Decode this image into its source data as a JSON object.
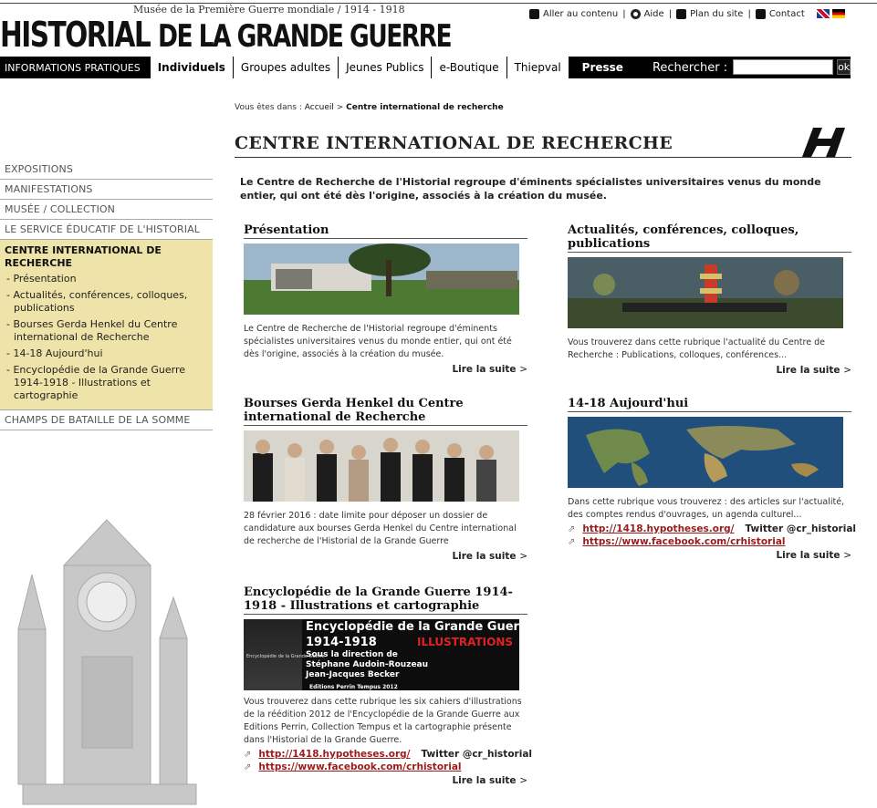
{
  "header": {
    "subtitle": "Musée de la Première Guerre mondiale / 1914 - 1918",
    "logo_word1": "HISTORIAL",
    "logo_word2": "DE LA GRANDE GUERRE",
    "util_links": [
      "Aller au contenu",
      "Aide",
      "Plan du site",
      "Contact"
    ],
    "util_icons": [
      "content-icon",
      "eye-icon",
      "sitemap-icon",
      "mail-icon"
    ]
  },
  "nav": {
    "items": [
      "INFORMATIONS PRATIQUES",
      "Individuels",
      "Groupes adultes",
      "Jeunes Publics",
      "e-Boutique",
      "Thiepval"
    ],
    "press": "Presse",
    "search_label": "Rechercher :",
    "search_value": "",
    "ok": "ok"
  },
  "sidebar": {
    "items_top": [
      "EXPOSITIONS",
      "MANIFESTATIONS",
      "MUSÉE / COLLECTION",
      "LE SERVICE ÉDUCATIF DE L'HISTORIAL"
    ],
    "active_head": "CENTRE INTERNATIONAL DE RECHERCHE",
    "active_sub": [
      "- Présentation",
      "- Actualités, conférences, colloques, publications",
      "- Bourses Gerda Henkel du Centre international de Recherche",
      "- 14-18 Aujourd'hui",
      "- Encyclopédie de la Grande Guerre 1914-1918 - Illustrations et cartographie"
    ],
    "items_bottom": [
      "CHAMPS DE BATAILLE DE LA SOMME"
    ]
  },
  "main": {
    "breadcrumb_prefix": "Vous êtes dans : ",
    "breadcrumb_home": "Accueil",
    "breadcrumb_sep": " > ",
    "breadcrumb_current": "Centre international de recherche",
    "title": "CENTRE INTERNATIONAL DE RECHERCHE",
    "intro": "Le Centre de Recherche de l'Historial regroupe d'éminents spécialistes universitaires venus du monde entier, qui ont été dès l'origine, associés à la création du musée.",
    "read_more": "Lire la suite",
    "read_more_arrow": ">",
    "cards": [
      {
        "title": "Présentation",
        "text": "Le Centre de Recherche de l'Historial regroupe d'éminents spécialistes universitaires venus du monde entier, qui ont été dès l'origine, associés à la création du musée."
      },
      {
        "title": "Actualités, conférences, colloques, publications",
        "text": "Vous trouverez dans cette rubrique l'actualité du Centre de Recherche : Publications, colloques, conférences..."
      },
      {
        "title": "Bourses Gerda Henkel du Centre international de Recherche",
        "text": "28 février 2016 : date limite pour déposer un dossier de candidature aux bourses Gerda Henkel du Centre international de recherche de l'Historial de la Grande Guerre"
      },
      {
        "title": "14-18 Aujourd'hui",
        "text": "Dans cette rubrique vous trouverez : des articles sur l'actualité, des comptes rendus d'ouvrages, un agenda culturel...",
        "link1": "http://1418.hypotheses.org/",
        "twitter": "Twitter @cr_historial",
        "link2": "https://www.facebook.com/crhistorial"
      },
      {
        "title": "Encyclopédie de la Grande Guerre 1914-1918 - Illustrations et cartographie",
        "text": "Vous trouverez dans cette rubrique les six cahiers d'illustrations de la réédition 2012 de l'Encyclopédie de la Grande Guerre aux Editions Perrin, Collection Tempus et la cartographie présente dans l'Historial de la Grande Guerre.",
        "link1": "http://1418.hypotheses.org/",
        "twitter": "Twitter @cr_historial",
        "link2": "https://www.facebook.com/crhistorial"
      }
    ],
    "ency_banner": {
      "line1": "Encyclopédie de la Grande Guerre",
      "line2": "1914-1918",
      "illus": "ILLUSTRATIONS",
      "line3": "Sous la direction de",
      "line4": "Stéphane Audoin-Rouzeau",
      "line5": "Jean-Jacques Becker",
      "line6": "Editions Perrin Tempus 2012",
      "side_text": "Encyclopédie de la Grande Guerre"
    }
  },
  "colors": {
    "nav_bg": "#000000",
    "sidebar_active_bg": "#eee3a8",
    "link_red": "#9a1b1b"
  }
}
